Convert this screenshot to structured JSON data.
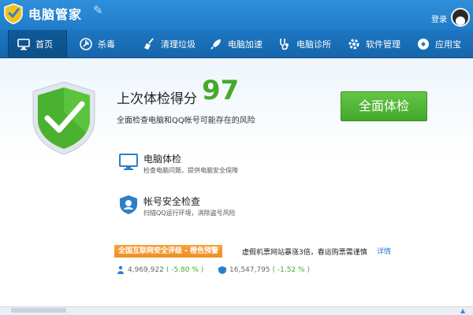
{
  "app": {
    "title": "电脑管家",
    "login_label": "登录"
  },
  "toolbar": {
    "tabs": [
      {
        "label": "首页",
        "icon": "monitor-icon",
        "active": true
      },
      {
        "label": "杀毒",
        "icon": "antivirus-icon",
        "active": false
      },
      {
        "label": "清理垃圾",
        "icon": "broom-icon",
        "active": false
      },
      {
        "label": "电脑加速",
        "icon": "rocket-icon",
        "active": false
      },
      {
        "label": "电脑诊所",
        "icon": "stethoscope-icon",
        "active": false
      },
      {
        "label": "软件管理",
        "icon": "gear-icon",
        "active": false
      },
      {
        "label": "应用宝",
        "icon": "app-store-icon",
        "active": false
      }
    ]
  },
  "checkup": {
    "score_label": "上次体检得分",
    "score": "97",
    "description": "全面检查电脑和QQ帐号可能存在的风险",
    "button_label": "全面体检"
  },
  "features": {
    "pc_check": {
      "title": "电脑体检",
      "description": "检查电脑问题，提供电脑安全保障"
    },
    "account_check": {
      "title": "帐号安全检查",
      "description": "扫描QQ运行环境，消除盗号风险"
    }
  },
  "alert": {
    "badge": "全国互联网安全评级 - 橙色预警",
    "text": "虚假机票网站暴涨3倍，春运购票需谨慎",
    "detail_link": "详情"
  },
  "stats": [
    {
      "value": "4,969,922",
      "change": "( -5.80 % )"
    },
    {
      "value": "16,547,795",
      "change": "( -1.52 % )"
    }
  ],
  "colors": {
    "titlebar": "#2f8fda",
    "toolbar": "#1d76c2",
    "accent_green": "#46a92b",
    "alert_orange": "#f29a31",
    "link_blue": "#2a7ad1"
  }
}
